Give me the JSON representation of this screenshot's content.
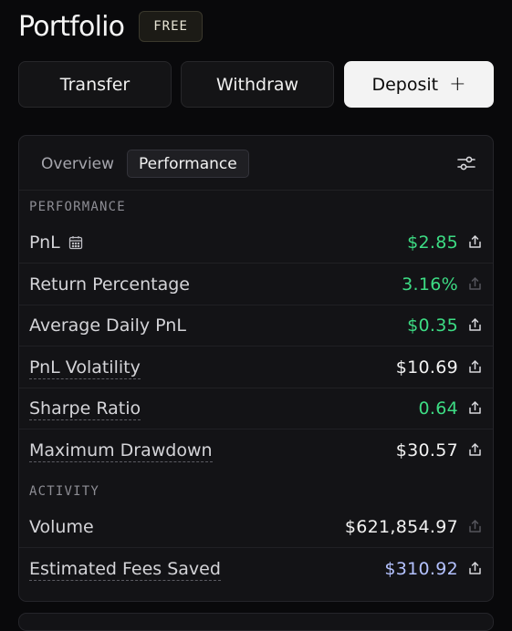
{
  "header": {
    "title": "Portfolio",
    "badge": "FREE"
  },
  "actions": {
    "transfer": "Transfer",
    "withdraw": "Withdraw",
    "deposit": "Deposit",
    "deposit_icon": "+"
  },
  "tabs": {
    "overview": "Overview",
    "performance": "Performance"
  },
  "sections": {
    "performance": {
      "label": "PERFORMANCE",
      "rows": [
        {
          "label": "PnL",
          "value": "$2.85",
          "color": "#3ddc84",
          "share_dim": false,
          "icon": "calendar-icon"
        },
        {
          "label": "Return Percentage",
          "value": "3.16%",
          "color": "#3ddc84",
          "share_dim": true
        },
        {
          "label": "Average Daily PnL",
          "value": "$0.35",
          "color": "#3ddc84",
          "share_dim": false
        },
        {
          "label": "PnL Volatility",
          "value": "$10.69",
          "color": "#f2f2f2",
          "share_dim": false,
          "dotted": true
        },
        {
          "label": "Sharpe Ratio",
          "value": "0.64",
          "color": "#3ddc84",
          "share_dim": false,
          "dotted": true
        },
        {
          "label": "Maximum Drawdown",
          "value": "$30.57",
          "color": "#f2f2f2",
          "share_dim": false,
          "dotted": true
        }
      ]
    },
    "activity": {
      "label": "ACTIVITY",
      "rows": [
        {
          "label": "Volume",
          "value": "$621,854.97",
          "color": "#f2f2f2",
          "share_dim": true
        },
        {
          "label": "Estimated Fees Saved",
          "value": "$310.92",
          "color": "#b4c2ff",
          "share_dim": false,
          "dotted": true
        }
      ]
    }
  },
  "icons": {
    "settings": "sliders-icon",
    "share": "share-icon",
    "calendar": "calendar-icon"
  }
}
